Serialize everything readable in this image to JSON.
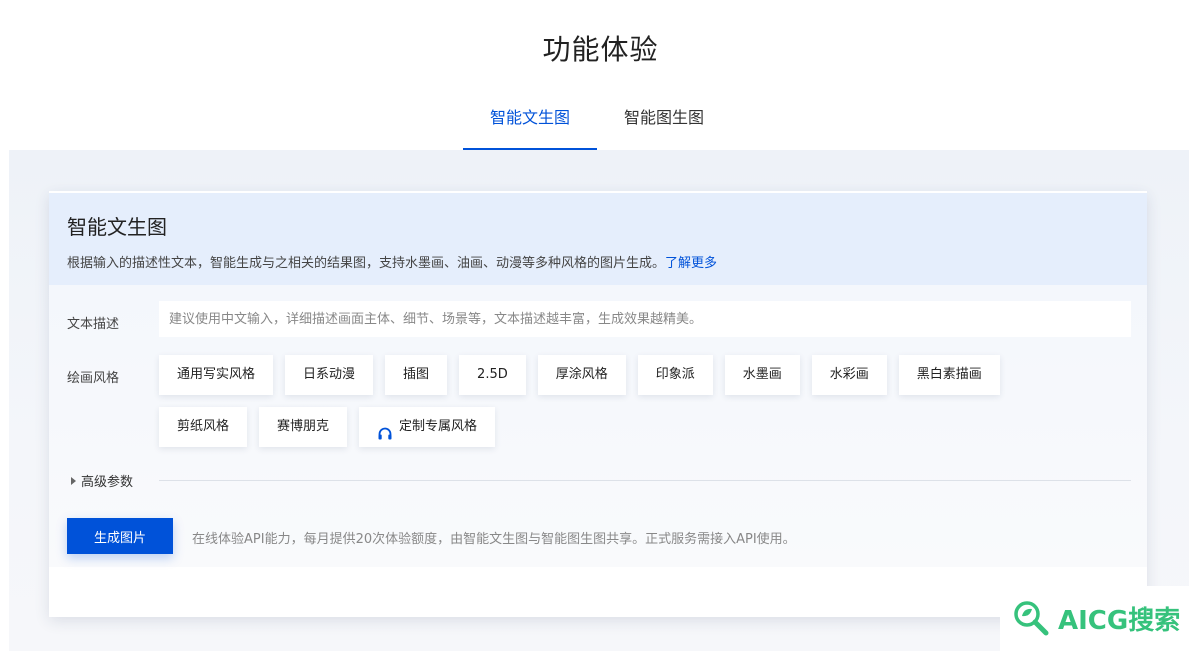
{
  "page": {
    "title": "功能体验"
  },
  "tabs": [
    {
      "label": "智能文生图",
      "active": true
    },
    {
      "label": "智能图生图",
      "active": false
    }
  ],
  "card": {
    "title": "智能文生图",
    "description": "根据输入的描述性文本，智能生成与之相关的结果图，支持水墨画、油画、动漫等多种风格的图片生成。",
    "learn_more": "了解更多"
  },
  "form": {
    "prompt_label": "文本描述",
    "prompt_placeholder": "建议使用中文输入，详细描述画面主体、细节、场景等，文本描述越丰富，生成效果越精美。",
    "prompt_value": "",
    "style_label": "绘画风格",
    "styles_row1": [
      "通用写实风格",
      "日系动漫",
      "插图",
      "2.5D",
      "厚涂风格",
      "印象派",
      "水墨画",
      "水彩画",
      "黑白素描画"
    ],
    "styles_row2": [
      "剪纸风格",
      "赛博朋克"
    ],
    "custom_style": {
      "label": "定制专属风格",
      "icon": "headset-icon"
    },
    "advanced_label": "高级参数",
    "generate_label": "生成图片",
    "generate_note": "在线体验API能力，每月提供20次体验额度，由智能文生图与智能图生图共享。正式服务需接入API使用。"
  },
  "watermark": {
    "text": "AICG搜索",
    "icon": "magnifier-leaf-icon",
    "color": "#36c27c"
  },
  "colors": {
    "accent": "#0052d9",
    "card_header_bg": "#e5eefc"
  }
}
